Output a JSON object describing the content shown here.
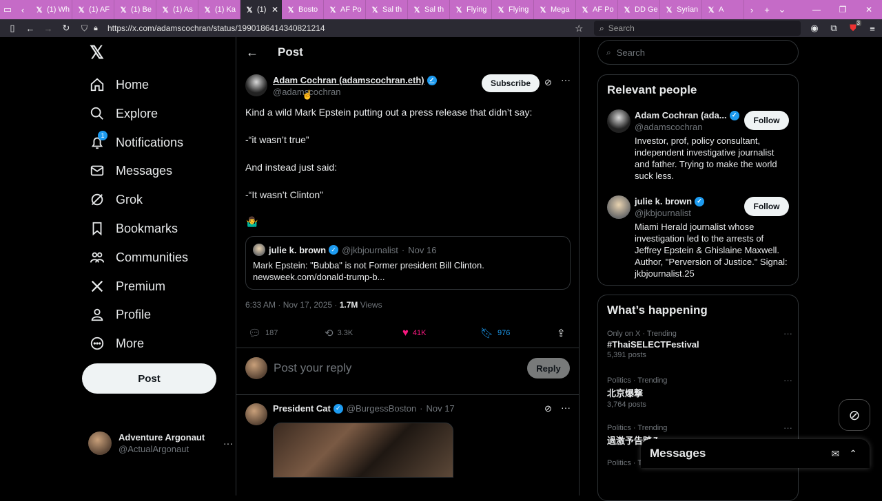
{
  "browser": {
    "tabs": [
      {
        "label": "(1) Wh",
        "icon": "x-logo"
      },
      {
        "label": "(1) AF",
        "icon": "x-logo"
      },
      {
        "label": "(1) Be",
        "icon": "x-logo"
      },
      {
        "label": "(1) As",
        "icon": "x-logo"
      },
      {
        "label": "(1) Ka",
        "icon": "x-logo"
      },
      {
        "label": "(1)",
        "icon": "x-logo"
      },
      {
        "label": "Bosto",
        "icon": "x-logo"
      },
      {
        "label": "AF Po",
        "icon": "x-logo"
      },
      {
        "label": "Sal th",
        "icon": "x-logo"
      },
      {
        "label": "Sal th",
        "icon": "x-logo"
      },
      {
        "label": "Flying",
        "icon": "x-logo"
      },
      {
        "label": "Flying",
        "icon": "x-logo"
      },
      {
        "label": "Mega",
        "icon": "x-logo"
      },
      {
        "label": "AF Po",
        "icon": "x-logo"
      },
      {
        "label": "DD Ge",
        "icon": "x-logo"
      },
      {
        "label": "Syrian",
        "icon": "x-logo"
      },
      {
        "label": "A",
        "icon": "x-logo"
      }
    ],
    "url": "https://x.com/adamscochran/status/1990186414340821214",
    "search_placeholder": "Search",
    "extension_badge": "3"
  },
  "nav": {
    "items": [
      {
        "label": "Home",
        "icon": "home-icon"
      },
      {
        "label": "Explore",
        "icon": "search-icon"
      },
      {
        "label": "Notifications",
        "icon": "bell-icon",
        "badge": "1"
      },
      {
        "label": "Messages",
        "icon": "mail-icon"
      },
      {
        "label": "Grok",
        "icon": "grok-icon"
      },
      {
        "label": "Bookmarks",
        "icon": "bookmark-icon"
      },
      {
        "label": "Communities",
        "icon": "communities-icon"
      },
      {
        "label": "Premium",
        "icon": "x-logo-icon"
      },
      {
        "label": "Profile",
        "icon": "person-icon"
      },
      {
        "label": "More",
        "icon": "more-circle-icon"
      }
    ],
    "post_button": "Post",
    "account": {
      "display_name": "Adventure Argonaut",
      "handle": "@ActualArgonaut"
    }
  },
  "main": {
    "header_title": "Post",
    "post": {
      "author_name": "Adam Cochran (adamscochran.eth)",
      "author_handle": "@adamscochran",
      "subscribe_label": "Subscribe",
      "lines": [
        "Kind a wild Mark Epstein putting out a press release that didn’t say:",
        "-“it wasn’t true”",
        "And instead just said:",
        "-“It wasn’t Clinton”"
      ],
      "emoji": "🤷‍♂️",
      "quote": {
        "author_name": "julie k. brown",
        "author_handle": "@jkbjournalist",
        "date": "Nov 16",
        "text": "Mark Epstein: \"Bubba\" is not Former president Bill Clinton. newsweek.com/donald-trump-b..."
      },
      "timestamp": "6:33 AM · Nov 17, 2025 · ",
      "views_count": "1.7M",
      "views_label": " Views",
      "stats": {
        "replies": "187",
        "reposts": "3.3K",
        "likes": "41K",
        "bookmarks": "976"
      }
    },
    "reply_placeholder": "Post your reply",
    "reply_button": "Reply",
    "reply_post": {
      "author_name": "President Cat",
      "author_handle": "@BurgessBoston",
      "date": "Nov 17"
    }
  },
  "right": {
    "search_placeholder": "Search",
    "relevant_title": "Relevant people",
    "people": [
      {
        "display_name": "Adam Cochran (ada...",
        "handle": "@adamscochran",
        "bio": "Investor, prof, policy consultant, independent investigative journalist and father. Trying to make the world suck less.",
        "follow_label": "Follow"
      },
      {
        "display_name": "julie k. brown",
        "handle": "@jkbjournalist",
        "bio": "Miami Herald journalist whose investigation led to the arrests of Jeffrey Epstein & Ghislaine Maxwell. Author, \"Perversion of Justice.\" Signal: jkbjournalist.25",
        "follow_label": "Follow"
      }
    ],
    "happening_title": "What’s happening",
    "trends": [
      {
        "context": "Only on X · Trending",
        "name": "#ThaiSELECTFestival",
        "count": "5,391 posts"
      },
      {
        "context": "Politics · Trending",
        "name": "北京爆撃",
        "count": "3,764 posts"
      },
      {
        "context": "Politics · Trending",
        "name": "過激予告踏み",
        "count": ""
      },
      {
        "context": "Politics · T",
        "name": "",
        "count": ""
      }
    ]
  },
  "messages_drawer": {
    "title": "Messages"
  }
}
